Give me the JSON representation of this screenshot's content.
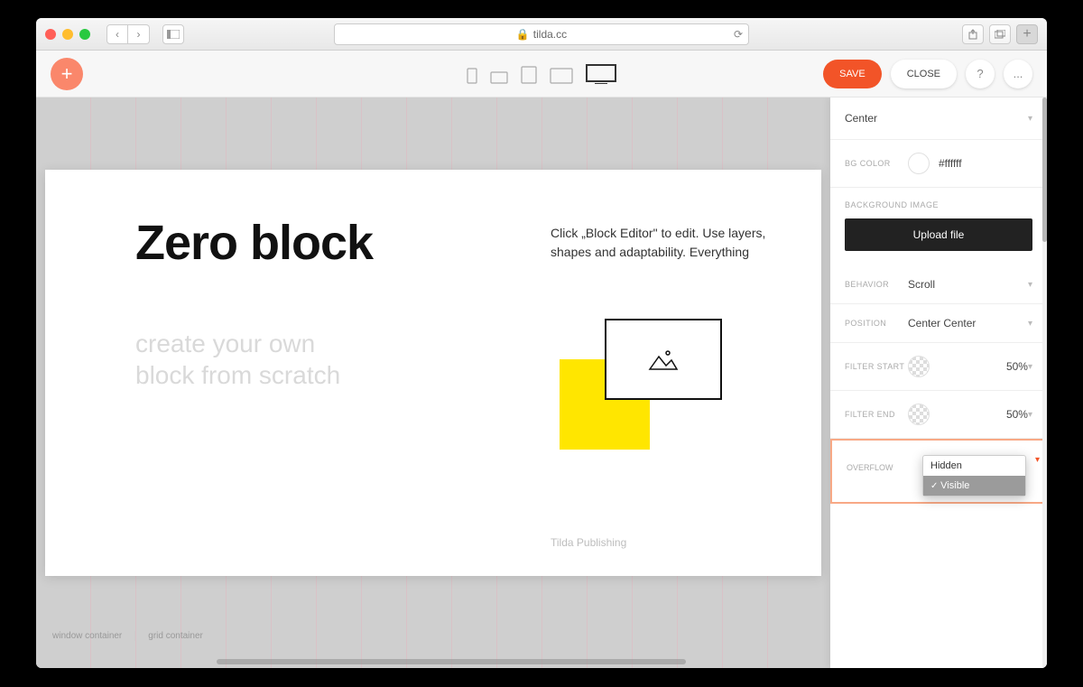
{
  "browser": {
    "url": "tilda.cc"
  },
  "toolbar": {
    "save": "SAVE",
    "close": "CLOSE",
    "help": "?",
    "more": "..."
  },
  "canvas": {
    "title": "Zero block",
    "subtitle_line1": "create your own",
    "subtitle_line2": "block from scratch",
    "description": "Click „Block Editor\" to edit. Use layers, shapes and adaptability. Everything",
    "footer": "Tilda Publishing",
    "label_window": "window container",
    "label_grid": "grid container"
  },
  "panel": {
    "align": "Center",
    "bgcolor_label": "BG COLOR",
    "bgcolor_value": "#ffffff",
    "bgimage_label": "BACKGROUND IMAGE",
    "upload": "Upload file",
    "behavior_label": "BEHAVIOR",
    "behavior_value": "Scroll",
    "position_label": "POSITION",
    "position_value": "Center Center",
    "filter_start_label": "FILTER START",
    "filter_start_value": "50%",
    "filter_end_label": "FILTER END",
    "filter_end_value": "50%",
    "overflow_label": "OVERFLOW",
    "overflow_options": {
      "hidden": "Hidden",
      "visible": "Visible"
    }
  }
}
